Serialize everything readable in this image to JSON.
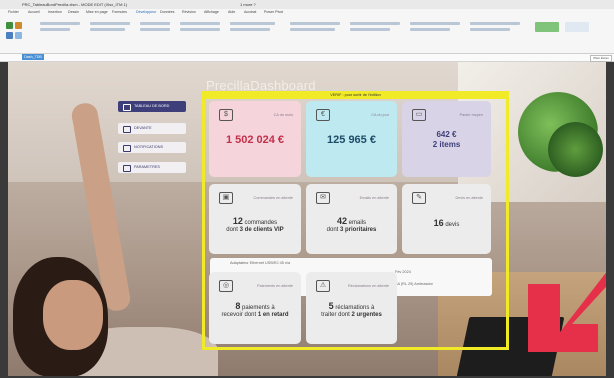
{
  "titlebar": {
    "filename": "PRC_TableauBordPrecilla.xlsm - MODE EDIT (Xlsx_ITM 1)",
    "user": "1 more ?"
  },
  "ribbon": {
    "tabs": [
      "Fichier",
      "Accueil",
      "Insertion",
      "Dessin",
      "Mise en page",
      "Formules",
      "Données",
      "Révision",
      "Affichage",
      "Développeur",
      "Aide",
      "Acrobat",
      "Power Pivot"
    ],
    "active_tab": "Développeur"
  },
  "sheet_tab": "Dash_TDB",
  "right_button": "Plein Écran",
  "dashboard": {
    "title": "PrecillaDashboard",
    "edit_notice": "VERIF : pour sortir de l'édition",
    "menu": [
      {
        "label": "TABLEAU DE BORD",
        "active": true
      },
      {
        "label": "DEVANTE",
        "active": false
      },
      {
        "label": "NOTIFICATIONS",
        "active": false
      },
      {
        "label": "PARAMETRES",
        "active": false
      }
    ],
    "kpis": [
      {
        "label": "CA du mois",
        "value": "1 502 024 €",
        "icon": "money-bag-icon"
      },
      {
        "label": "CA du jour",
        "value": "125 965 €",
        "icon": "banknote-icon"
      },
      {
        "label": "Panier moyen",
        "value": "642 €",
        "value2": "2 items",
        "icon": "basket-icon"
      }
    ],
    "tasks": [
      {
        "label": "Commandes en attente",
        "count": "12",
        "text1": "commandes",
        "text2": "dont",
        "bold": "3 de clients VIP",
        "icon": "box-icon"
      },
      {
        "label": "Emails en attente",
        "count": "42",
        "text1": "emails",
        "text2": "dont",
        "bold": "3 prioritaires",
        "icon": "email-icon"
      },
      {
        "label": "Devis en attente",
        "count": "16",
        "text1": "devis",
        "text2": "",
        "bold": "",
        "icon": "document-icon"
      },
      {
        "label": "Paiements en attente",
        "count": "8",
        "text1": "paiements à",
        "text2": "recevoir dont",
        "bold": "1 en retard",
        "icon": "coins-icon"
      },
      {
        "label": "Réclamations en attente",
        "count": "5",
        "text1": "réclamations à",
        "text2": "traiter dont",
        "bold": "2 urgentes",
        "icon": "warning-icon"
      }
    ],
    "strip": {
      "row1": "Adaptateur Ethernet USB/RJ 45 n/a",
      "row2": "Fév 2024",
      "row3": "SA (RL 29) Ambrasdor"
    }
  },
  "colors": {
    "highlight": "#f1ea26",
    "accent_red": "#e6304a",
    "menu_active": "#3e3f7a"
  }
}
